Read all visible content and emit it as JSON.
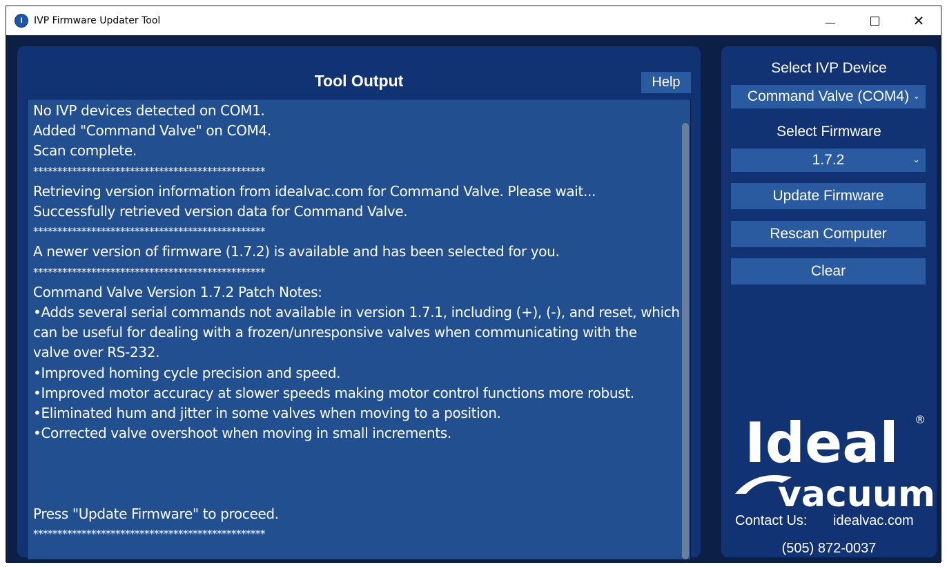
{
  "window": {
    "title": "IVP Firmware Updater Tool",
    "icon": "ivp-app-icon",
    "controls": [
      "minimize",
      "maximize",
      "close"
    ]
  },
  "output_panel": {
    "title": "Tool Output",
    "help_label": "Help",
    "lines": [
      {
        "text": "No IVP devices detected on COM1.",
        "type": "text"
      },
      {
        "text": "Added \"Command Valve\" on COM4.",
        "type": "text"
      },
      {
        "text": "Scan complete.",
        "type": "text"
      },
      {
        "text": "************************************************",
        "type": "sep"
      },
      {
        "text": "Retrieving version information from idealvac.com for Command Valve. Please wait...",
        "type": "text"
      },
      {
        "text": "Successfully retrieved version data for Command Valve.",
        "type": "text"
      },
      {
        "text": "************************************************",
        "type": "sep"
      },
      {
        "text": "A newer version of firmware (1.7.2) is available and has been selected for you.",
        "type": "text"
      },
      {
        "text": "************************************************",
        "type": "sep"
      },
      {
        "text": "Command Valve Version 1.7.2 Patch Notes:",
        "type": "text"
      },
      {
        "text": "•Adds several serial commands not available in version 1.7.1, including (+), (-), and reset, which",
        "type": "text"
      },
      {
        "text": "can be useful for dealing with a frozen/unresponsive valves when communicating with the",
        "type": "text"
      },
      {
        "text": "valve over RS-232.",
        "type": "text"
      },
      {
        "text": "•Improved homing cycle precision and speed.",
        "type": "text"
      },
      {
        "text": "•Improved motor accuracy at slower speeds making motor control functions more robust.",
        "type": "text"
      },
      {
        "text": "•Eliminated hum and jitter in some valves when moving to a position.",
        "type": "text"
      },
      {
        "text": "•Corrected valve overshoot when moving in small increments.",
        "type": "text"
      },
      {
        "text": "",
        "type": "text"
      },
      {
        "text": "",
        "type": "text"
      },
      {
        "text": "",
        "type": "text"
      },
      {
        "text": "Press \"Update Firmware\" to proceed.",
        "type": "text"
      },
      {
        "text": "************************************************",
        "type": "sep"
      }
    ]
  },
  "side_panel": {
    "device_label": "Select IVP Device",
    "device_value": "Command Valve (COM4)",
    "firmware_label": "Select Firmware",
    "firmware_value": "1.7.2",
    "update_label": "Update Firmware",
    "rescan_label": "Rescan Computer",
    "clear_label": "Clear",
    "logo_word_top": "Ideal",
    "logo_word_bottom": "vacuum",
    "registered_mark": "®",
    "contact_label": "Contact Us:",
    "website": "idealvac.com",
    "phone": "(505) 872-0037"
  },
  "colors": {
    "background": "#0c1f47",
    "panel": "#123373",
    "output_bg": "#224f8f",
    "button": "#2a5aa0",
    "text": "#ffffff"
  }
}
